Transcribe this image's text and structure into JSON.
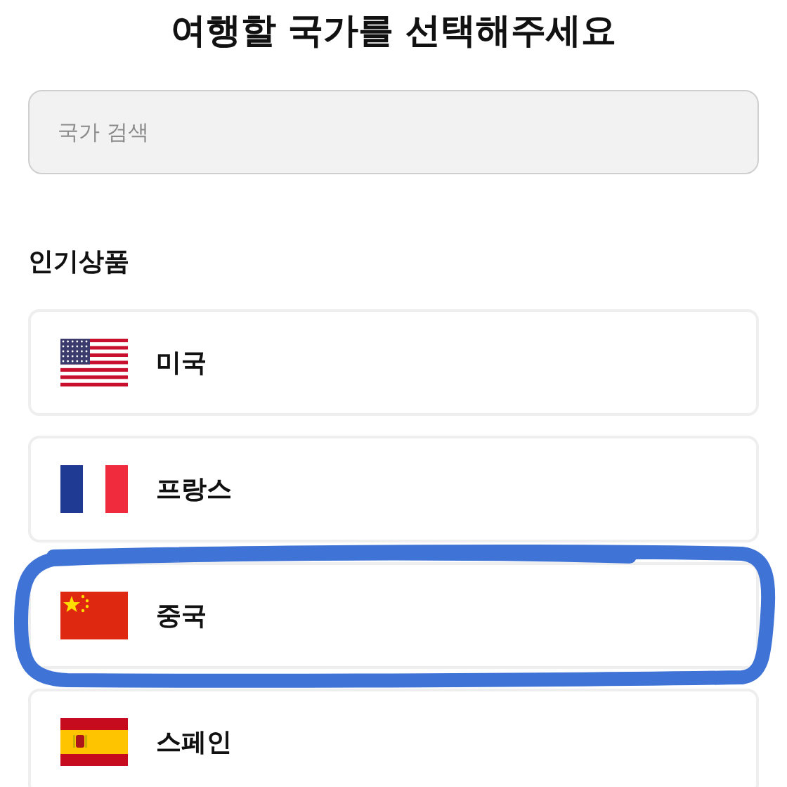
{
  "title": "여행할 국가를 선택해주세요",
  "search": {
    "placeholder": "국가 검색"
  },
  "section": {
    "title": "인기상품"
  },
  "countries": [
    {
      "name": "미국",
      "kind": "us",
      "highlighted": false
    },
    {
      "name": "프랑스",
      "kind": "fr",
      "highlighted": false
    },
    {
      "name": "중국",
      "kind": "cn",
      "highlighted": true
    },
    {
      "name": "스페인",
      "kind": "es",
      "highlighted": false
    }
  ]
}
